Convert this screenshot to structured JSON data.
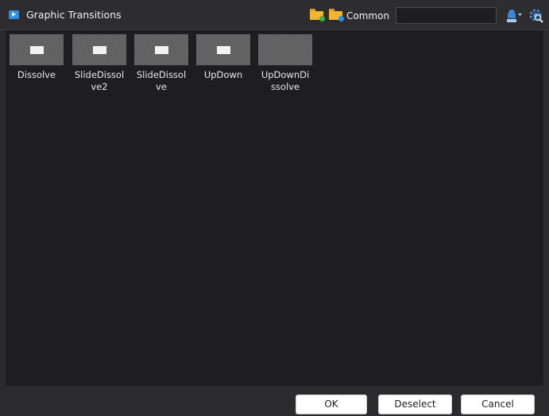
{
  "window": {
    "title": "Graphic Transitions"
  },
  "toolbar": {
    "folder_label": "Common",
    "search_value": "",
    "icons": [
      "folder-add-icon",
      "folder-open-icon",
      "sort-abc-icon",
      "settings-search-icon"
    ]
  },
  "items": [
    {
      "label": "Dissolve",
      "thumbnail": "white-bar"
    },
    {
      "label": "SlideDissolve2",
      "thumbnail": "white-bar"
    },
    {
      "label": "SlideDissolve",
      "thumbnail": "white-bar"
    },
    {
      "label": "UpDown",
      "thumbnail": "white-bar"
    },
    {
      "label": "UpDownDissolve",
      "thumbnail": "empty"
    }
  ],
  "buttons": {
    "ok": "OK",
    "deselect": "Deselect",
    "cancel": "Cancel"
  },
  "colors": {
    "accent": "#2f8ee0",
    "folder": "#f0b62e",
    "background": "#1e1e20"
  }
}
